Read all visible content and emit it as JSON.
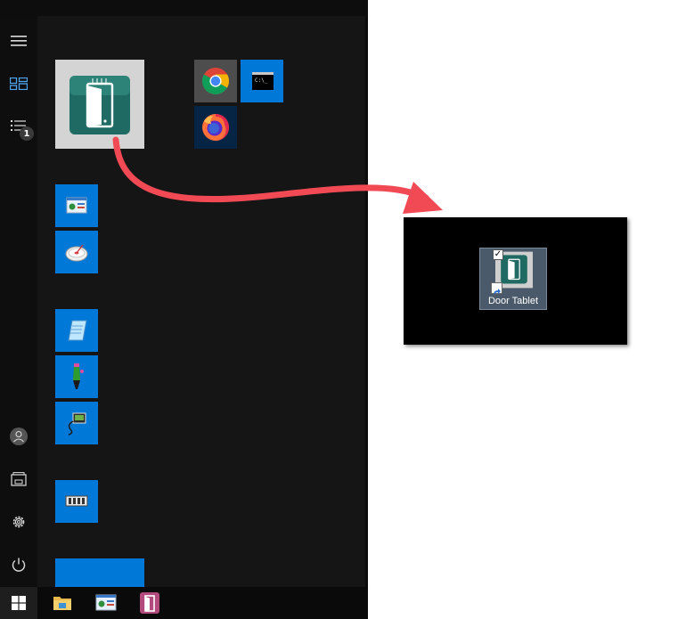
{
  "start_menu": {
    "rail": {
      "items": [
        {
          "name": "Expand"
        },
        {
          "name": "All apps tiles"
        },
        {
          "name": "Apps list"
        }
      ],
      "list_badge": "1",
      "bottom": [
        {
          "name": "User account"
        },
        {
          "name": "Documents"
        },
        {
          "name": "Settings"
        },
        {
          "name": "Power"
        }
      ]
    },
    "tiles": [
      {
        "name": "Door Tablet",
        "icon": "door-tablet-icon"
      },
      {
        "name": "Google Chrome",
        "icon": "chrome-icon"
      },
      {
        "name": "Command Prompt",
        "icon": "console-icon"
      },
      {
        "name": "Firefox",
        "icon": "firefox-icon"
      },
      {
        "name": "Control Panel",
        "icon": "control-panel-icon"
      },
      {
        "name": "Disk tool",
        "icon": "disk-icon"
      },
      {
        "name": "Notepad",
        "icon": "notepad-icon"
      },
      {
        "name": "Paint",
        "icon": "paint-icon"
      },
      {
        "name": "Network",
        "icon": "network-icon"
      },
      {
        "name": "Memory",
        "icon": "memory-icon"
      }
    ]
  },
  "taskbar": {
    "items": [
      {
        "name": "Start",
        "icon": "windows-logo-icon"
      },
      {
        "name": "File Explorer",
        "icon": "folder-icon"
      },
      {
        "name": "Control Panel",
        "icon": "control-panel-icon"
      },
      {
        "name": "Door Tablet",
        "icon": "door-tablet-icon"
      }
    ]
  },
  "desktop": {
    "shortcut_label": "Door Tablet",
    "checked": true
  },
  "colors": {
    "start_bg": "#151515",
    "tile_blue": "#0078d7",
    "accent_arrow": "#f24a55",
    "desktop_bg": "#000000"
  }
}
